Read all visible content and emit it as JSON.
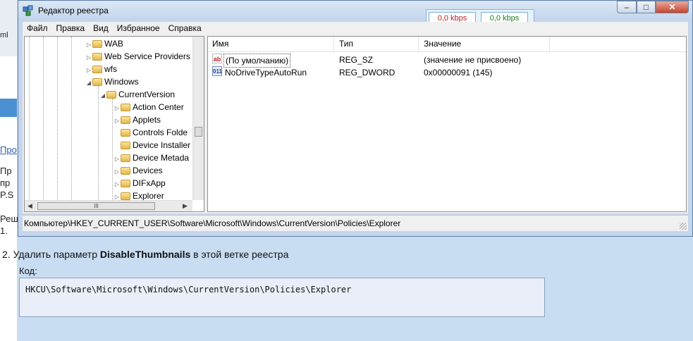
{
  "window": {
    "title": "Редактор реестра",
    "kbps_down": "0,0 kbps",
    "kbps_up": "0,0 kbps",
    "controls": {
      "minimize": "–",
      "maximize": "□",
      "close": "✕"
    }
  },
  "menu": [
    "Файл",
    "Правка",
    "Вид",
    "Избранное",
    "Справка"
  ],
  "tree": [
    {
      "label": "WAB",
      "level": 0,
      "expander": "▷"
    },
    {
      "label": "Web Service Providers",
      "level": 0,
      "expander": "▷"
    },
    {
      "label": "wfs",
      "level": 0,
      "expander": "▷"
    },
    {
      "label": "Windows",
      "level": 0,
      "expander": "◢"
    },
    {
      "label": "CurrentVersion",
      "level": 1,
      "expander": "◢"
    },
    {
      "label": "Action Center",
      "level": 2,
      "expander": "▷"
    },
    {
      "label": "Applets",
      "level": 2,
      "expander": "▷"
    },
    {
      "label": "Controls Folde",
      "level": 2,
      "expander": ""
    },
    {
      "label": "Device Installer",
      "level": 2,
      "expander": ""
    },
    {
      "label": "Device Metada",
      "level": 2,
      "expander": "▷"
    },
    {
      "label": "Devices",
      "level": 2,
      "expander": "▷"
    },
    {
      "label": "DIFxApp",
      "level": 2,
      "expander": "▷"
    },
    {
      "label": "Explorer",
      "level": 2,
      "expander": "▷"
    }
  ],
  "hscroll_thumb_glyph": "III",
  "list": {
    "columns": [
      "Имя",
      "Тип",
      "Значение"
    ],
    "rows": [
      {
        "icon": "ab",
        "name": "(По умолчанию)",
        "type": "REG_SZ",
        "value": "(значение не присвоено)"
      },
      {
        "icon": "011",
        "name": "NoDriveTypeAutoRun",
        "type": "REG_DWORD",
        "value": "0x00000091 (145)"
      }
    ]
  },
  "statusbar": {
    "path": "Компьютер\\HKEY_CURRENT_USER\\Software\\Microsoft\\Windows\\CurrentVersion\\Policies\\Explorer"
  },
  "background_page": {
    "fragments": [
      "ml",
      "Про",
      "Пр",
      "пр",
      "P.S",
      "Реш",
      "1."
    ],
    "step2_prefix": "2. Удалить параметр ",
    "step2_bold": "DisableThumbnails",
    "step2_suffix": " в этой ветке реестра",
    "code_label": "Код:",
    "code_text": "HKCU\\Software\\Microsoft\\Windows\\CurrentVersion\\Policies\\Explorer"
  }
}
